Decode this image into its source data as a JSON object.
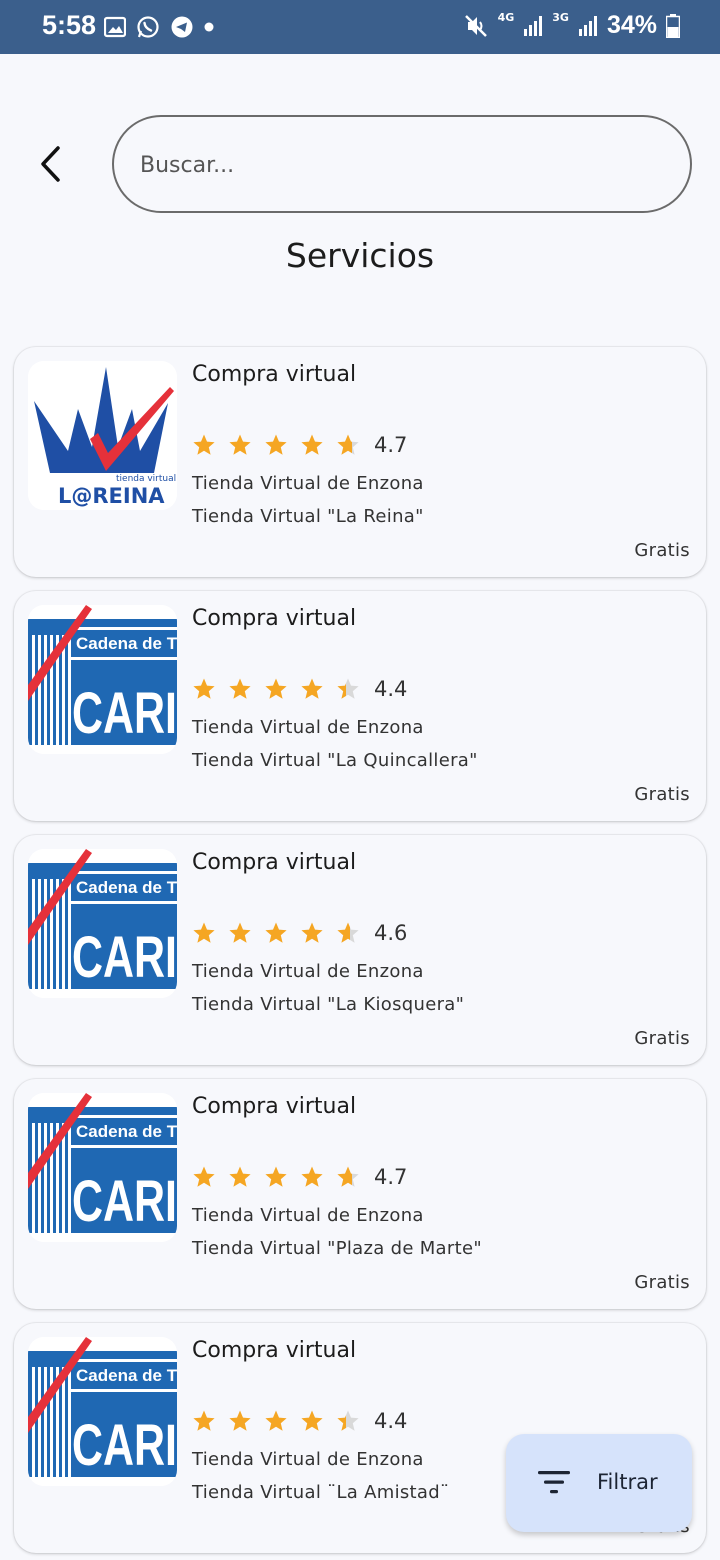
{
  "status_bar": {
    "time": "5:58",
    "network_1": "4G",
    "network_2": "3G",
    "battery": "34%"
  },
  "search": {
    "placeholder": "Buscar..."
  },
  "page": {
    "title": "Servicios"
  },
  "colors": {
    "status_bar": "#3b5f8c",
    "star": "#f5a623",
    "star_empty": "#d9d9d9",
    "fab_bg": "#d6e3fb"
  },
  "items": [
    {
      "title": "Compra virtual",
      "rating": "4.7",
      "rating_value": 4.7,
      "line1": "Tienda Virtual de Enzona",
      "line2": "Tienda Virtual \"La Reina\"",
      "price": "Gratis",
      "logo": "lareina-logo",
      "logo_text": "tienda virtual L@REINA"
    },
    {
      "title": "Compra virtual",
      "rating": "4.4",
      "rating_value": 4.4,
      "line1": "Tienda Virtual de Enzona",
      "line2": "Tienda Virtual \"La Quincallera\"",
      "price": "Gratis",
      "logo": "caribe-logo",
      "logo_text": "Cadena de Tie CARI"
    },
    {
      "title": "Compra virtual",
      "rating": "4.6",
      "rating_value": 4.6,
      "line1": "Tienda Virtual de Enzona",
      "line2": "Tienda Virtual \"La Kiosquera\"",
      "price": "Gratis",
      "logo": "caribe-logo",
      "logo_text": "Cadena de Tie CARI"
    },
    {
      "title": "Compra virtual",
      "rating": "4.7",
      "rating_value": 4.7,
      "line1": "Tienda Virtual de Enzona",
      "line2": "Tienda Virtual \"Plaza de Marte\"",
      "price": "Gratis",
      "logo": "caribe-logo",
      "logo_text": "Cadena de Tie CARI"
    },
    {
      "title": "Compra virtual",
      "rating": "4.4",
      "rating_value": 4.4,
      "line1": "Tienda Virtual de Enzona",
      "line2": "Tienda Virtual ¨La Amistad¨",
      "price": "Gratis",
      "logo": "caribe-logo",
      "logo_text": "Cadena de Tie CARI"
    }
  ],
  "fab": {
    "label": "Filtrar",
    "icon": "filter-icon"
  }
}
